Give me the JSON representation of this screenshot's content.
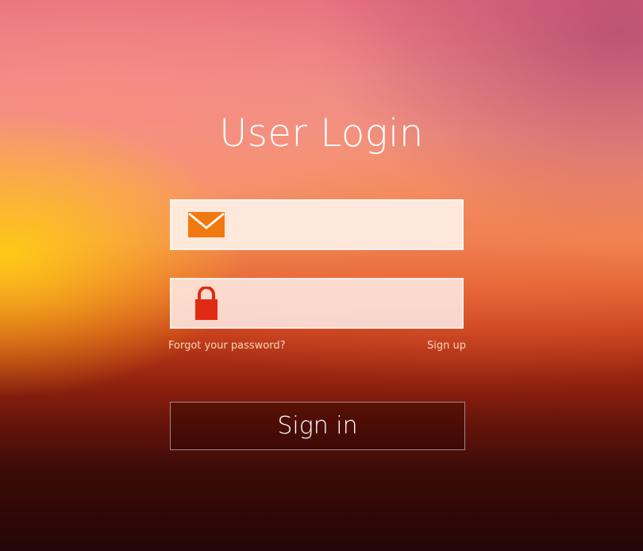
{
  "login": {
    "title": "User Login",
    "email_field": {
      "value": "",
      "placeholder": "",
      "icon": "envelope-icon"
    },
    "password_field": {
      "value": "",
      "placeholder": "",
      "icon": "lock-icon"
    },
    "forgot_password_label": "Forgot your password?",
    "sign_up_label": "Sign up",
    "sign_in_label": "Sign in"
  },
  "colors": {
    "icon_orange": "#f07a10",
    "lock_red": "#e02a14",
    "text_white": "#ffffff"
  }
}
